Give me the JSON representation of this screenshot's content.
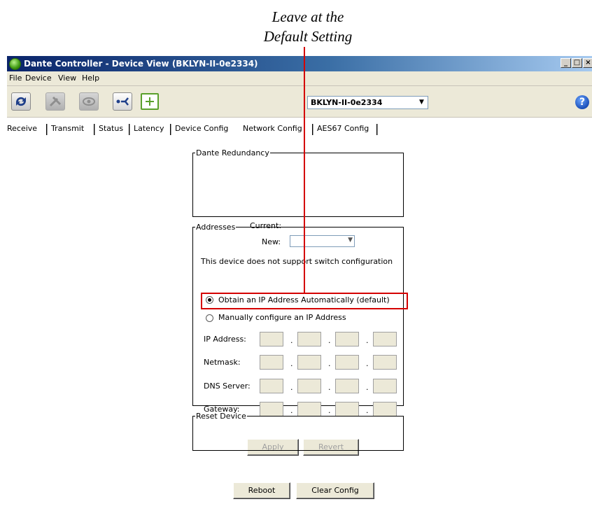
{
  "annotation": {
    "line1": "Leave at the",
    "line2": "Default Setting"
  },
  "window": {
    "title": "Dante Controller - Device View (BKLYN-II-0e2334)",
    "min": "_",
    "max": "□",
    "close": "×"
  },
  "menu": {
    "file": "File",
    "device": "Device",
    "view": "View",
    "help": "Help"
  },
  "toolbar": {
    "device": "BKLYN-II-0e2334",
    "help_icon": "?"
  },
  "tabs": [
    "Receive",
    "Transmit",
    "Status",
    "Latency",
    "Device Config",
    "Network Config",
    "AES67 Config"
  ],
  "redundancy": {
    "title": "Dante Redundancy",
    "current_label": "Current:",
    "new_label": "New:",
    "new_value": "",
    "note": "This device does not support switch configuration"
  },
  "addresses": {
    "title": "Addresses",
    "auto_option": "Obtain an IP Address Automatically (default)",
    "manual_option": "Manually configure an IP Address",
    "auto_selected": true,
    "ip_label": "IP Address:",
    "netmask_label": "Netmask:",
    "dns_label": "DNS Server:",
    "gateway_label": "Gateway:",
    "apply": "Apply",
    "revert": "Revert"
  },
  "reset": {
    "title": "Reset Device",
    "reboot": "Reboot",
    "clear": "Clear Config"
  },
  "colors": {
    "highlight": "#d40000",
    "titlebar": "#0a246a"
  }
}
